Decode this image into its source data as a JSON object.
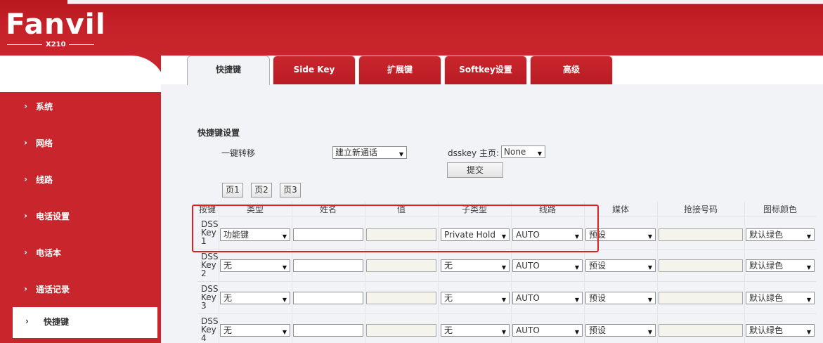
{
  "brand": {
    "logo": "Fanvil",
    "model": "X210"
  },
  "sidebar": {
    "items": [
      {
        "label": "系统",
        "active": false
      },
      {
        "label": "网络",
        "active": false
      },
      {
        "label": "线路",
        "active": false
      },
      {
        "label": "电话设置",
        "active": false
      },
      {
        "label": "电话本",
        "active": false
      },
      {
        "label": "通话记录",
        "active": false
      },
      {
        "label": "快捷键",
        "active": true
      }
    ],
    "chevron": "›"
  },
  "tabs": [
    {
      "label": "快捷键",
      "active": true
    },
    {
      "label": "Side Key",
      "active": false
    },
    {
      "label": "扩展键",
      "active": false
    },
    {
      "label": "Softkey设置",
      "active": false
    },
    {
      "label": "高级",
      "active": false
    }
  ],
  "settings": {
    "section_title": "快捷键设置",
    "onekey_label": "一键转移",
    "onekey_value": "建立新通话",
    "dss_home_label": "dsskey 主页:",
    "dss_home_value": "None",
    "submit_label": "提交"
  },
  "pages": [
    "页1",
    "页2",
    "页3"
  ],
  "table": {
    "headers": [
      "按键",
      "类型",
      "姓名",
      "值",
      "子类型",
      "线路",
      "媒体",
      "抢接号码",
      "图标颜色"
    ],
    "rows": [
      {
        "name": "DSS Key 1",
        "type": "功能键",
        "subtype": "Private Hold",
        "line": "AUTO",
        "media": "预设",
        "color": "默认绿色"
      },
      {
        "name": "DSS Key 2",
        "type": "无",
        "subtype": "无",
        "line": "AUTO",
        "media": "预设",
        "color": "默认绿色"
      },
      {
        "name": "DSS Key 3",
        "type": "无",
        "subtype": "无",
        "line": "AUTO",
        "media": "预设",
        "color": "默认绿色"
      },
      {
        "name": "DSS Key 4",
        "type": "无",
        "subtype": "无",
        "line": "AUTO",
        "media": "预设",
        "color": "默认绿色"
      }
    ]
  },
  "colors": {
    "brand_red": "#c9252c",
    "highlight": "#e02020"
  }
}
